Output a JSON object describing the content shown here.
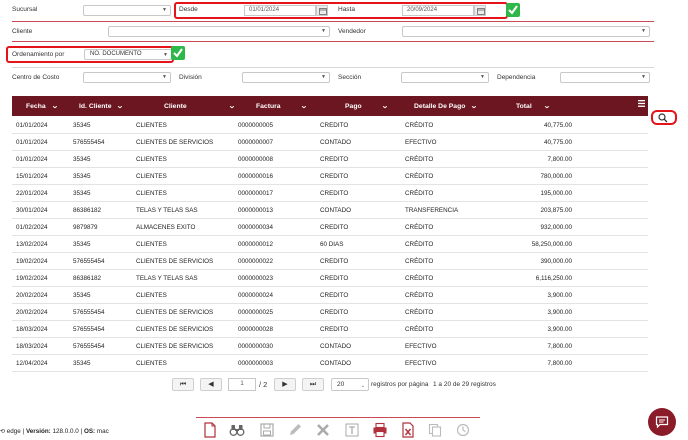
{
  "filters": {
    "sucursal_label": "Sucursal",
    "desde_label": "Desde",
    "desde_value": "01/01/2024",
    "hasta_label": "Hasta",
    "hasta_value": "20/09/2024",
    "cliente_label": "Cliente",
    "vendedor_label": "Vendedor",
    "ordenamiento_label": "Ordenamiento por",
    "ordenamiento_value": "NO. DOCUMENTO",
    "centro_costo_label": "Centro de Costo",
    "division_label": "División",
    "seccion_label": "Sección",
    "dependencia_label": "Dependencia"
  },
  "table": {
    "columns": [
      "Fecha",
      "Id. Cliente",
      "Cliente",
      "Factura",
      "Pago",
      "Detalle De Pago",
      "Total"
    ],
    "rows": [
      [
        "01/01/2024",
        "35345",
        "CLIENTES",
        "0000000005",
        "CREDITO",
        "CRÉDITO",
        "40,775.00"
      ],
      [
        "01/01/2024",
        "576555454",
        "CLIENTES DE SERVICIOS",
        "0000000007",
        "CONTADO",
        "EFECTIVO",
        "40,775.00"
      ],
      [
        "01/01/2024",
        "35345",
        "CLIENTES",
        "0000000008",
        "CREDITO",
        "CRÉDITO",
        "7,800.00"
      ],
      [
        "15/01/2024",
        "35345",
        "CLIENTES",
        "0000000016",
        "CREDITO",
        "CRÉDITO",
        "780,000.00"
      ],
      [
        "22/01/2024",
        "35345",
        "CLIENTES",
        "0000000017",
        "CREDITO",
        "CRÉDITO",
        "195,000.00"
      ],
      [
        "30/01/2024",
        "86386182",
        "TELAS Y TELAS SAS",
        "0000000013",
        "CONTADO",
        "TRANSFERENCIA",
        "203,875.00"
      ],
      [
        "01/02/2024",
        "9879879",
        "ALMACENES EXITO",
        "0000000034",
        "CREDITO",
        "CRÉDITO",
        "932,000.00"
      ],
      [
        "13/02/2024",
        "35345",
        "CLIENTES",
        "0000000012",
        "60 DIAS",
        "CRÉDITO",
        "58,250,000.00"
      ],
      [
        "19/02/2024",
        "576555454",
        "CLIENTES DE SERVICIOS",
        "0000000022",
        "CREDITO",
        "CRÉDITO",
        "390,000.00"
      ],
      [
        "19/02/2024",
        "86386182",
        "TELAS Y TELAS SAS",
        "0000000023",
        "CREDITO",
        "CRÉDITO",
        "6,116,250.00"
      ],
      [
        "20/02/2024",
        "35345",
        "CLIENTES",
        "0000000024",
        "CREDITO",
        "CRÉDITO",
        "3,900.00"
      ],
      [
        "20/02/2024",
        "576555454",
        "CLIENTES DE SERVICIOS",
        "0000000025",
        "CREDITO",
        "CRÉDITO",
        "3,900.00"
      ],
      [
        "18/03/2024",
        "576555454",
        "CLIENTES DE SERVICIOS",
        "0000000028",
        "CREDITO",
        "CRÉDITO",
        "3,900.00"
      ],
      [
        "18/03/2024",
        "576555454",
        "CLIENTES DE SERVICIOS",
        "0000000030",
        "CONTADO",
        "EFECTIVO",
        "7,800.00"
      ],
      [
        "12/04/2024",
        "35345",
        "CLIENTES",
        "0000000003",
        "CONTADO",
        "EFECTIVO",
        "7,800.00"
      ]
    ]
  },
  "pager": {
    "first": "⏮",
    "prev": "◀",
    "page": "1",
    "of_pages": "/ 2",
    "next": "▶",
    "last": "⏭",
    "page_size": "20",
    "per_page_label": "registros por página",
    "range_text": "1 a 20 de 29 registros"
  },
  "footer": {
    "browser_info_prefix": "edge | ",
    "version_label": "Versión:",
    "version_value": "128.0.0.0",
    "os_label": "OS:",
    "os_value": "mac"
  },
  "colors": {
    "accent": "#6b1620",
    "highlight": "#e5141b",
    "ok": "#2fb84a"
  }
}
